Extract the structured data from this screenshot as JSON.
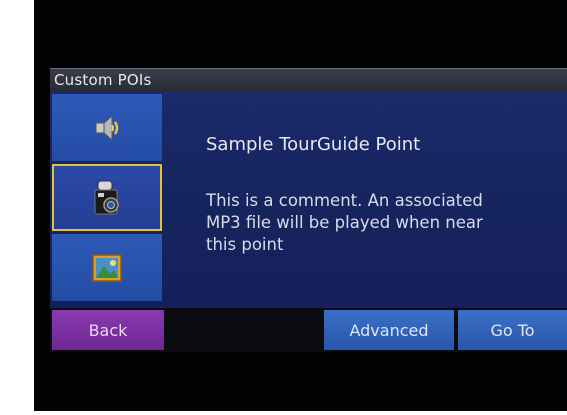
{
  "window": {
    "title": "Custom POIs"
  },
  "categories": [
    {
      "icon": "speaker-icon",
      "selected": false
    },
    {
      "icon": "camera-icon",
      "selected": true
    },
    {
      "icon": "picture-icon",
      "selected": false
    }
  ],
  "poi": {
    "name": "Sample TourGuide Point",
    "comment": "This is a comment. An associated\nMP3 file will be played when near\nthis point"
  },
  "buttons": {
    "back": "Back",
    "advanced": "Advanced",
    "go_to": "Go To"
  },
  "colors": {
    "background": "#14205a",
    "button_blue": "#2d5ab8",
    "back_purple": "#7a30a0",
    "selected_border": "#e3c238"
  }
}
